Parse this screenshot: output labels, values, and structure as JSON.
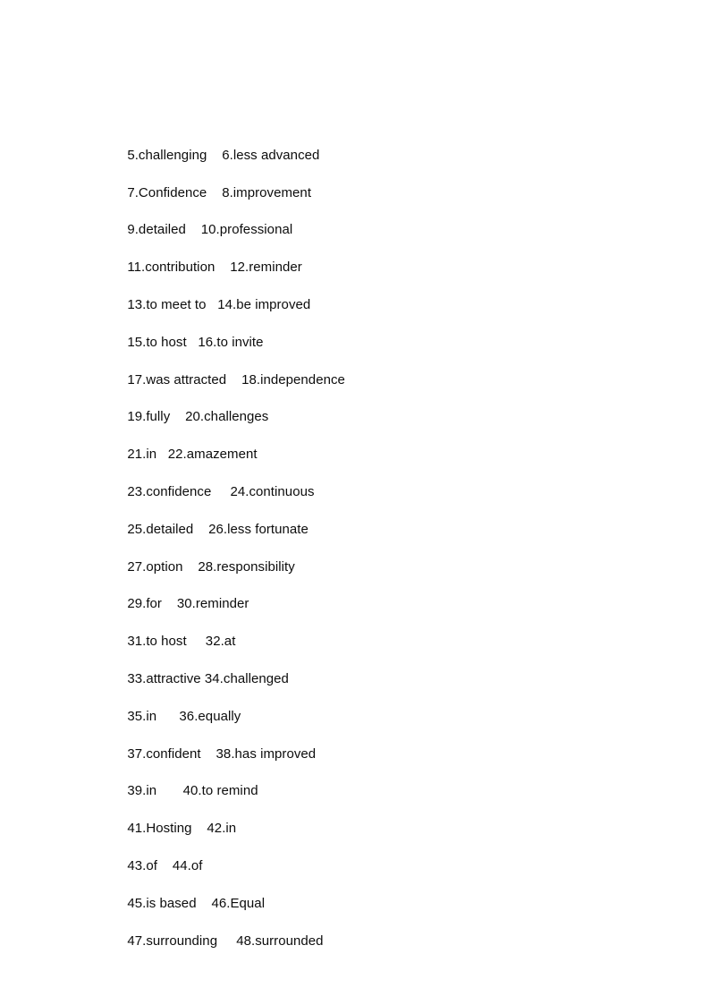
{
  "document": {
    "type": "answer-key",
    "page_background": "#ffffff",
    "text_color": "#0d0d0d",
    "lines": [
      {
        "left": "5.challenging",
        "gap": "    ",
        "right": "6.less advanced"
      },
      {
        "left": "7.Confidence",
        "gap": "    ",
        "right": "8.improvement"
      },
      {
        "left": "9.detailed",
        "gap": "    ",
        "right": "10.professional"
      },
      {
        "left": "11.contribution",
        "gap": "    ",
        "right": "12.reminder"
      },
      {
        "left": "13.to meet to",
        "gap": "   ",
        "right": "14.be improved"
      },
      {
        "left": "15.to host",
        "gap": "   ",
        "right": "16.to invite"
      },
      {
        "left": "17.was attracted",
        "gap": "    ",
        "right": "18.independence"
      },
      {
        "left": "19.fully",
        "gap": "    ",
        "right": "20.challenges"
      },
      {
        "left": "21.in",
        "gap": "   ",
        "right": "22.amazement"
      },
      {
        "left": "23.confidence",
        "gap": "     ",
        "right": "24.continuous"
      },
      {
        "left": "25.detailed",
        "gap": "    ",
        "right": "26.less fortunate"
      },
      {
        "left": "27.option",
        "gap": "    ",
        "right": "28.responsibility"
      },
      {
        "left": "29.for",
        "gap": "    ",
        "right": "30.reminder"
      },
      {
        "left": "31.to host",
        "gap": "     ",
        "right": "32.at"
      },
      {
        "left": "33.attractive",
        "gap": " ",
        "right": "34.challenged"
      },
      {
        "left": "35.in",
        "gap": "      ",
        "right": "36.equally"
      },
      {
        "left": "37.confident",
        "gap": "    ",
        "right": "38.has improved"
      },
      {
        "left": "39.in",
        "gap": "       ",
        "right": "40.to remind"
      },
      {
        "left": "41.Hosting",
        "gap": "    ",
        "right": "42.in"
      },
      {
        "left": "43.of",
        "gap": "    ",
        "right": "44.of"
      },
      {
        "left": "45.is based",
        "gap": "    ",
        "right": "46.Equal"
      },
      {
        "left": "47.surrounding",
        "gap": "     ",
        "right": "48.surrounded"
      }
    ]
  }
}
